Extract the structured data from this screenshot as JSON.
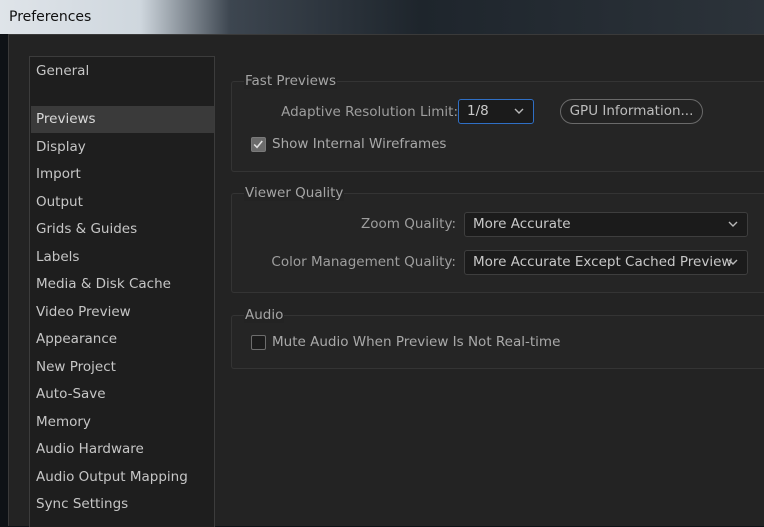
{
  "window": {
    "title": "Preferences"
  },
  "sidebar": {
    "items": [
      {
        "label": "General",
        "selected": false
      },
      {
        "label": "Previews",
        "selected": true
      },
      {
        "label": "Display",
        "selected": false
      },
      {
        "label": "Import",
        "selected": false
      },
      {
        "label": "Output",
        "selected": false
      },
      {
        "label": "Grids & Guides",
        "selected": false
      },
      {
        "label": "Labels",
        "selected": false
      },
      {
        "label": "Media & Disk Cache",
        "selected": false
      },
      {
        "label": "Video Preview",
        "selected": false
      },
      {
        "label": "Appearance",
        "selected": false
      },
      {
        "label": "New Project",
        "selected": false
      },
      {
        "label": "Auto-Save",
        "selected": false
      },
      {
        "label": "Memory",
        "selected": false
      },
      {
        "label": "Audio Hardware",
        "selected": false
      },
      {
        "label": "Audio Output Mapping",
        "selected": false
      },
      {
        "label": "Sync Settings",
        "selected": false
      }
    ]
  },
  "fast_previews": {
    "title": "Fast Previews",
    "adaptive_label": "Adaptive Resolution Limit:",
    "adaptive_value": "1/8",
    "gpu_button": "GPU Information...",
    "wireframes_label": "Show Internal Wireframes",
    "wireframes_checked": true
  },
  "viewer_quality": {
    "title": "Viewer Quality",
    "zoom_label": "Zoom Quality:",
    "zoom_value": "More Accurate",
    "color_label": "Color Management Quality:",
    "color_value": "More Accurate Except Cached Preview"
  },
  "audio": {
    "title": "Audio",
    "mute_label": "Mute Audio When Preview Is Not Real-time",
    "mute_checked": false
  },
  "colors": {
    "focus_accent": "#2f6fc5",
    "selected_item_bg": "#3a3a3a",
    "panel_bg": "#232323"
  }
}
